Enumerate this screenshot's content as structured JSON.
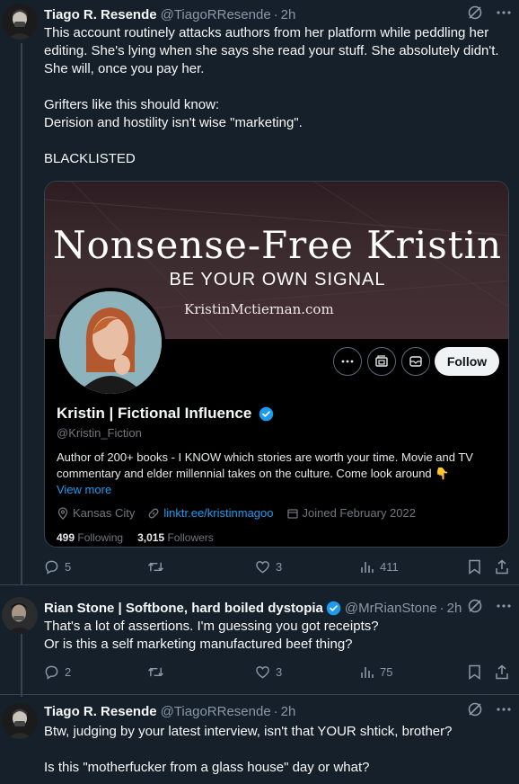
{
  "tweets": [
    {
      "name": "Tiago R. Resende",
      "handle": "@TiagoRResende",
      "dot": "·",
      "time": "2h",
      "text": "This account routinely attacks authors from her platform while peddling her editing. She's lying when she says she read your stuff. She absolutely didn't. She will, once you pay her.\n\nGrifters like this should know:\nDerision and hostility isn't wise \"marketing\".\n\nBLACKLISTED",
      "replies": "5",
      "retweets": "",
      "likes": "3",
      "views": "411"
    },
    {
      "name": "Rian Stone | Softbone, hard boiled dystopia",
      "handle": "@MrRianStone",
      "dot": "·",
      "time": "2h",
      "text": "That's a lot of assertions. I'm guessing you got receipts?\nOr is this a self marketing manufactured beef thing?",
      "replies": "2",
      "retweets": "",
      "likes": "3",
      "views": "75"
    },
    {
      "name": "Tiago R. Resende",
      "handle": "@TiagoRResende",
      "dot": "·",
      "time": "2h",
      "text": "Btw, judging by your latest interview, isn't that YOUR shtick, brother?\n\nIs this \"motherfucker from a glass house\" day or what?"
    }
  ],
  "card": {
    "banner_title": "Nonsense-Free Kristin",
    "banner_subtitle": "BE YOUR OWN SIGNAL",
    "banner_url": "KristinMctiernan.com",
    "follow_label": "Follow",
    "profile_name": "Kristin | Fictional Influence",
    "profile_handle": "@Kristin_Fiction",
    "bio": "Author of 200+ books - I KNOW which stories are worth your time. Movie and TV commentary and elder millennial takes on the culture. Come look around 👇",
    "view_more": "View more",
    "location": "Kansas City",
    "link": "linktr.ee/kristinmagoo",
    "joined": "Joined February 2022",
    "following_count": "499",
    "following_label": "Following",
    "followers_count": "3,015",
    "followers_label": "Followers"
  },
  "colors": {
    "background": "#15202b",
    "accent": "#1d9bf0",
    "muted": "#8b98a5"
  },
  "icons": [
    "grok-icon",
    "more-icon",
    "reply-icon",
    "retweet-icon",
    "like-icon",
    "views-icon",
    "bookmark-icon",
    "share-icon",
    "verified-icon",
    "location-icon",
    "link-icon",
    "calendar-icon",
    "message-icon",
    "notify-icon"
  ]
}
